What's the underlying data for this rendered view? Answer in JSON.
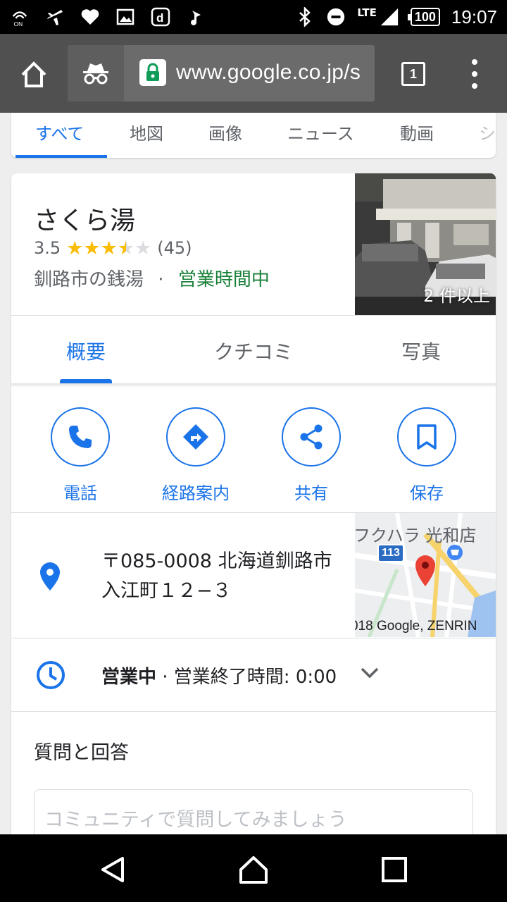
{
  "status_bar": {
    "icons": [
      "nfc-on-icon",
      "airplane-icon",
      "heart-icon",
      "image-icon",
      "d-app-icon",
      "music-icon",
      "bluetooth-icon",
      "do-not-disturb-icon",
      "signal-icon"
    ],
    "nfc_label": "ON",
    "d_label": "d",
    "network": "LTE",
    "battery": "100",
    "time": "19:07"
  },
  "browser": {
    "url": "www.google.co.jp/s",
    "tab_count": "1",
    "icons": [
      "home-icon",
      "incognito-icon",
      "lock-icon",
      "menu-icon"
    ]
  },
  "search_tabs": [
    "すべて",
    "地図",
    "画像",
    "ニュース",
    "動画",
    "シ"
  ],
  "place": {
    "name": "さくら湯",
    "rating": "3.5",
    "rating_value": 3.5,
    "review_count": "(45)",
    "category": "釧路市の銭湯",
    "separator": "·",
    "open_status": "営業時間中",
    "photo_label": "2 件以上",
    "star_color": "#fbbc04",
    "star_empty_color": "#dadce0"
  },
  "detail_tabs": [
    "概要",
    "クチコミ",
    "写真"
  ],
  "actions": [
    {
      "label": "電話",
      "icon": "phone-icon"
    },
    {
      "label": "経路案内",
      "icon": "directions-icon"
    },
    {
      "label": "共有",
      "icon": "share-icon"
    },
    {
      "label": "保存",
      "icon": "bookmark-icon"
    }
  ],
  "address": {
    "line1": "〒085-0008 北海道釧路市",
    "line2": "入江町１２−３",
    "map_title": "フクハラ 光和店",
    "map_route": "113",
    "map_copyright": "018 Google, ZENRIN"
  },
  "hours": {
    "status": "営業中",
    "detail": " · 営業終了時間: 0:00"
  },
  "qa": {
    "title": "質問と回答",
    "placeholder": "コミュニティで質問してみましょう"
  },
  "colors": {
    "accent": "#1a73e8",
    "open_green": "#188038",
    "toolbar": "#505050"
  }
}
